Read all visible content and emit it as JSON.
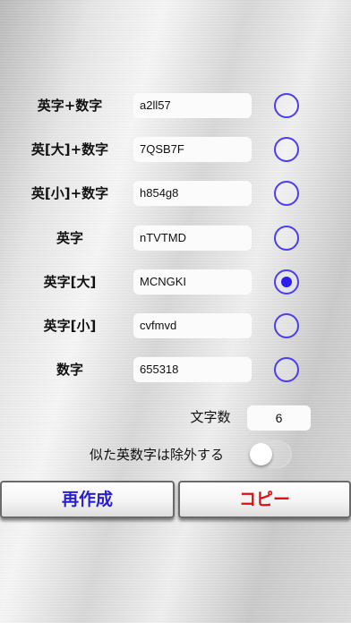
{
  "rows": [
    {
      "label": "英字+数字",
      "value": "a2ll57",
      "selected": false
    },
    {
      "label": "英[大]+数字",
      "value": "7QSB7F",
      "selected": false
    },
    {
      "label": "英[小]+数字",
      "value": "h854g8",
      "selected": false
    },
    {
      "label": "英字",
      "value": "nTVTMD",
      "selected": false
    },
    {
      "label": "英字[大]",
      "value": "MCNGKI",
      "selected": true
    },
    {
      "label": "英字[小]",
      "value": "cvfmvd",
      "selected": false
    },
    {
      "label": "数字",
      "value": "655318",
      "selected": false
    }
  ],
  "length": {
    "label": "文字数",
    "value": "6"
  },
  "exclude_similar": {
    "label": "似た英数字は除外する",
    "on": false
  },
  "buttons": {
    "regenerate": "再作成",
    "copy": "コピー"
  },
  "colors": {
    "accent": "#2a1ff0",
    "copy": "#e01010"
  }
}
